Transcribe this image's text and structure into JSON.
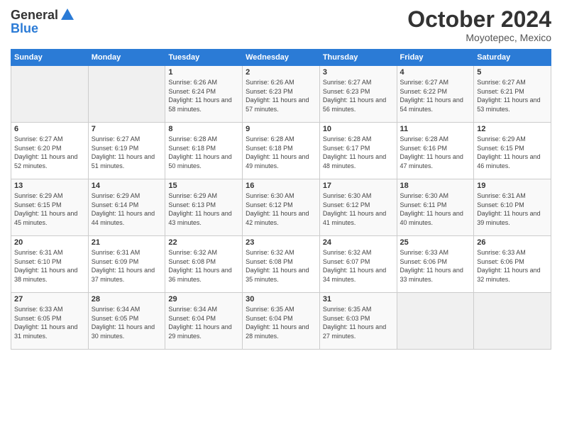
{
  "header": {
    "logo_general": "General",
    "logo_blue": "Blue",
    "month_title": "October 2024",
    "location": "Moyotepec, Mexico"
  },
  "days_of_week": [
    "Sunday",
    "Monday",
    "Tuesday",
    "Wednesday",
    "Thursday",
    "Friday",
    "Saturday"
  ],
  "weeks": [
    [
      {
        "num": "",
        "empty": true
      },
      {
        "num": "",
        "empty": true
      },
      {
        "num": "1",
        "sunrise": "Sunrise: 6:26 AM",
        "sunset": "Sunset: 6:24 PM",
        "daylight": "Daylight: 11 hours and 58 minutes."
      },
      {
        "num": "2",
        "sunrise": "Sunrise: 6:26 AM",
        "sunset": "Sunset: 6:23 PM",
        "daylight": "Daylight: 11 hours and 57 minutes."
      },
      {
        "num": "3",
        "sunrise": "Sunrise: 6:27 AM",
        "sunset": "Sunset: 6:23 PM",
        "daylight": "Daylight: 11 hours and 56 minutes."
      },
      {
        "num": "4",
        "sunrise": "Sunrise: 6:27 AM",
        "sunset": "Sunset: 6:22 PM",
        "daylight": "Daylight: 11 hours and 54 minutes."
      },
      {
        "num": "5",
        "sunrise": "Sunrise: 6:27 AM",
        "sunset": "Sunset: 6:21 PM",
        "daylight": "Daylight: 11 hours and 53 minutes."
      }
    ],
    [
      {
        "num": "6",
        "sunrise": "Sunrise: 6:27 AM",
        "sunset": "Sunset: 6:20 PM",
        "daylight": "Daylight: 11 hours and 52 minutes."
      },
      {
        "num": "7",
        "sunrise": "Sunrise: 6:27 AM",
        "sunset": "Sunset: 6:19 PM",
        "daylight": "Daylight: 11 hours and 51 minutes."
      },
      {
        "num": "8",
        "sunrise": "Sunrise: 6:28 AM",
        "sunset": "Sunset: 6:18 PM",
        "daylight": "Daylight: 11 hours and 50 minutes."
      },
      {
        "num": "9",
        "sunrise": "Sunrise: 6:28 AM",
        "sunset": "Sunset: 6:18 PM",
        "daylight": "Daylight: 11 hours and 49 minutes."
      },
      {
        "num": "10",
        "sunrise": "Sunrise: 6:28 AM",
        "sunset": "Sunset: 6:17 PM",
        "daylight": "Daylight: 11 hours and 48 minutes."
      },
      {
        "num": "11",
        "sunrise": "Sunrise: 6:28 AM",
        "sunset": "Sunset: 6:16 PM",
        "daylight": "Daylight: 11 hours and 47 minutes."
      },
      {
        "num": "12",
        "sunrise": "Sunrise: 6:29 AM",
        "sunset": "Sunset: 6:15 PM",
        "daylight": "Daylight: 11 hours and 46 minutes."
      }
    ],
    [
      {
        "num": "13",
        "sunrise": "Sunrise: 6:29 AM",
        "sunset": "Sunset: 6:15 PM",
        "daylight": "Daylight: 11 hours and 45 minutes."
      },
      {
        "num": "14",
        "sunrise": "Sunrise: 6:29 AM",
        "sunset": "Sunset: 6:14 PM",
        "daylight": "Daylight: 11 hours and 44 minutes."
      },
      {
        "num": "15",
        "sunrise": "Sunrise: 6:29 AM",
        "sunset": "Sunset: 6:13 PM",
        "daylight": "Daylight: 11 hours and 43 minutes."
      },
      {
        "num": "16",
        "sunrise": "Sunrise: 6:30 AM",
        "sunset": "Sunset: 6:12 PM",
        "daylight": "Daylight: 11 hours and 42 minutes."
      },
      {
        "num": "17",
        "sunrise": "Sunrise: 6:30 AM",
        "sunset": "Sunset: 6:12 PM",
        "daylight": "Daylight: 11 hours and 41 minutes."
      },
      {
        "num": "18",
        "sunrise": "Sunrise: 6:30 AM",
        "sunset": "Sunset: 6:11 PM",
        "daylight": "Daylight: 11 hours and 40 minutes."
      },
      {
        "num": "19",
        "sunrise": "Sunrise: 6:31 AM",
        "sunset": "Sunset: 6:10 PM",
        "daylight": "Daylight: 11 hours and 39 minutes."
      }
    ],
    [
      {
        "num": "20",
        "sunrise": "Sunrise: 6:31 AM",
        "sunset": "Sunset: 6:10 PM",
        "daylight": "Daylight: 11 hours and 38 minutes."
      },
      {
        "num": "21",
        "sunrise": "Sunrise: 6:31 AM",
        "sunset": "Sunset: 6:09 PM",
        "daylight": "Daylight: 11 hours and 37 minutes."
      },
      {
        "num": "22",
        "sunrise": "Sunrise: 6:32 AM",
        "sunset": "Sunset: 6:08 PM",
        "daylight": "Daylight: 11 hours and 36 minutes."
      },
      {
        "num": "23",
        "sunrise": "Sunrise: 6:32 AM",
        "sunset": "Sunset: 6:08 PM",
        "daylight": "Daylight: 11 hours and 35 minutes."
      },
      {
        "num": "24",
        "sunrise": "Sunrise: 6:32 AM",
        "sunset": "Sunset: 6:07 PM",
        "daylight": "Daylight: 11 hours and 34 minutes."
      },
      {
        "num": "25",
        "sunrise": "Sunrise: 6:33 AM",
        "sunset": "Sunset: 6:06 PM",
        "daylight": "Daylight: 11 hours and 33 minutes."
      },
      {
        "num": "26",
        "sunrise": "Sunrise: 6:33 AM",
        "sunset": "Sunset: 6:06 PM",
        "daylight": "Daylight: 11 hours and 32 minutes."
      }
    ],
    [
      {
        "num": "27",
        "sunrise": "Sunrise: 6:33 AM",
        "sunset": "Sunset: 6:05 PM",
        "daylight": "Daylight: 11 hours and 31 minutes."
      },
      {
        "num": "28",
        "sunrise": "Sunrise: 6:34 AM",
        "sunset": "Sunset: 6:05 PM",
        "daylight": "Daylight: 11 hours and 30 minutes."
      },
      {
        "num": "29",
        "sunrise": "Sunrise: 6:34 AM",
        "sunset": "Sunset: 6:04 PM",
        "daylight": "Daylight: 11 hours and 29 minutes."
      },
      {
        "num": "30",
        "sunrise": "Sunrise: 6:35 AM",
        "sunset": "Sunset: 6:04 PM",
        "daylight": "Daylight: 11 hours and 28 minutes."
      },
      {
        "num": "31",
        "sunrise": "Sunrise: 6:35 AM",
        "sunset": "Sunset: 6:03 PM",
        "daylight": "Daylight: 11 hours and 27 minutes."
      },
      {
        "num": "",
        "empty": true
      },
      {
        "num": "",
        "empty": true
      }
    ]
  ]
}
